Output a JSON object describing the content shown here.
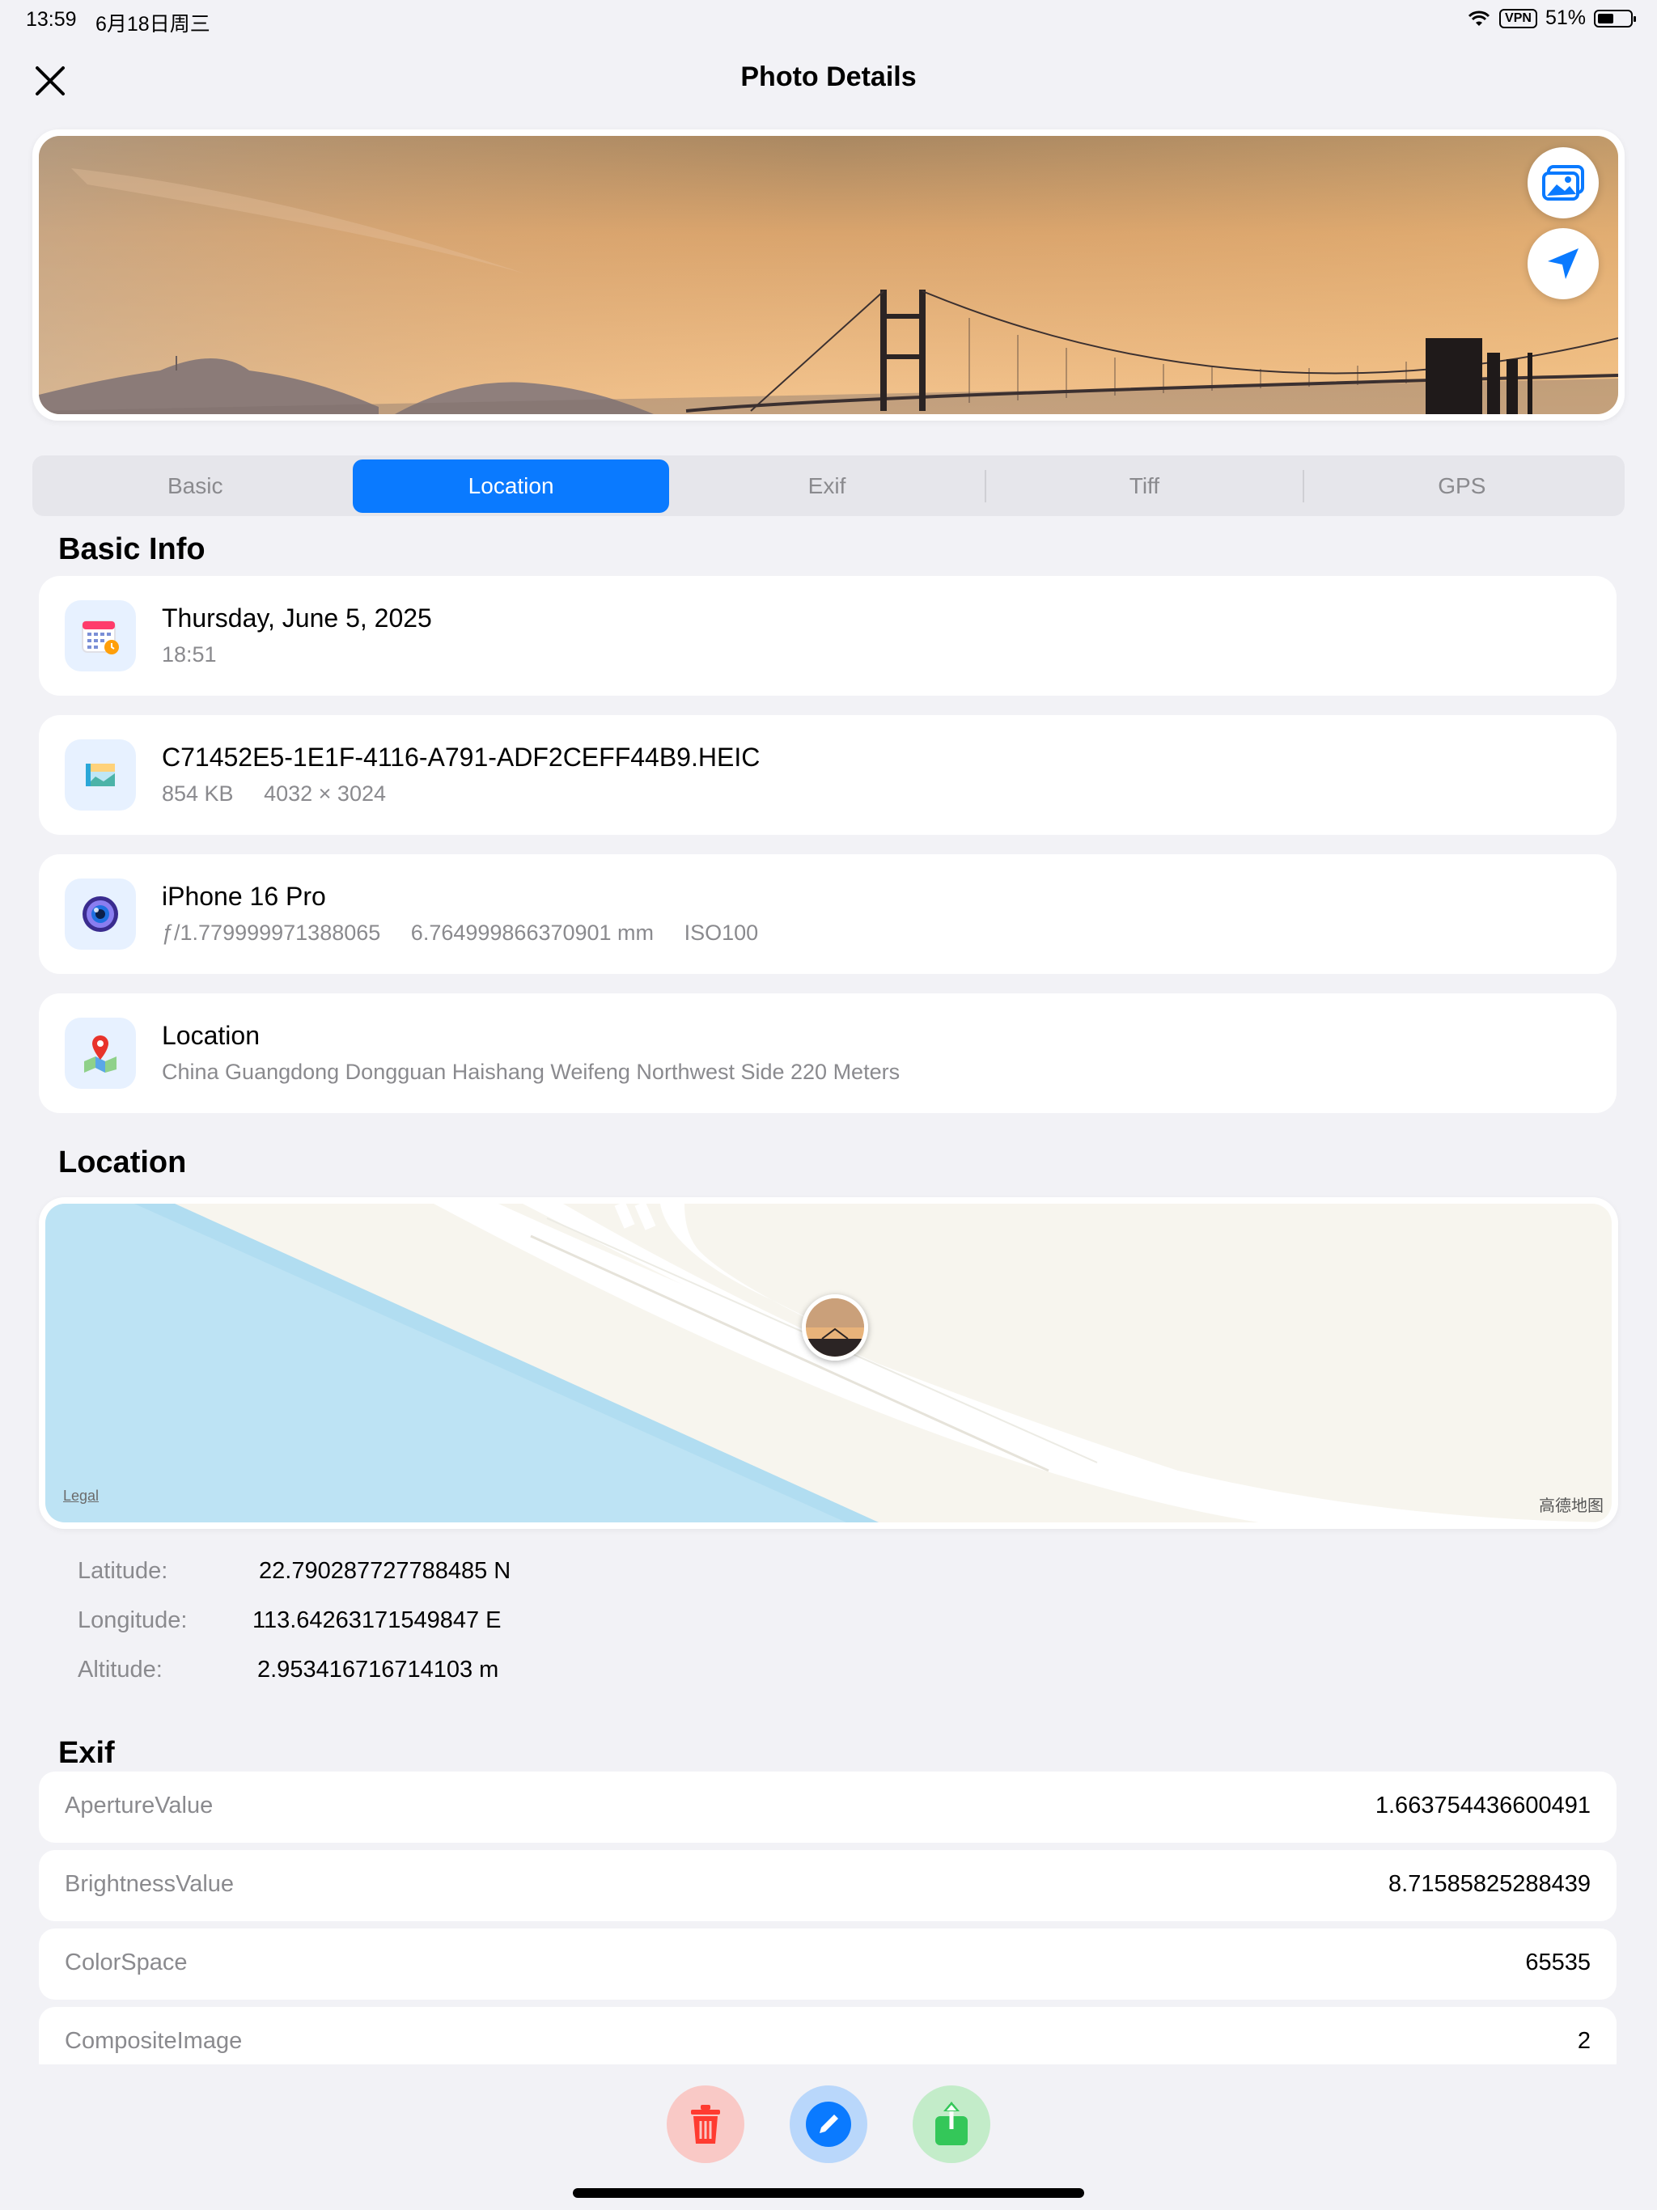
{
  "status_bar": {
    "time": "13:59",
    "date": "6月18日周三",
    "vpn": "VPN",
    "battery_pct": "51%",
    "battery_level": 0.51
  },
  "nav": {
    "title": "Photo Details"
  },
  "tabs": [
    {
      "label": "Basic"
    },
    {
      "label": "Location"
    },
    {
      "label": "Exif"
    },
    {
      "label": "Tiff"
    },
    {
      "label": "GPS"
    }
  ],
  "active_tab": "Location",
  "basic_info": {
    "heading": "Basic Info",
    "date": {
      "title": "Thursday, June 5, 2025",
      "time": "18:51"
    },
    "file": {
      "name": "C71452E5-1E1F-4116-A791-ADF2CEFF44B9.HEIC",
      "size": "854 KB",
      "dimensions": "4032 × 3024"
    },
    "camera": {
      "model": "iPhone 16 Pro",
      "aperture": "ƒ/1.779999971388065",
      "focal_length": "6.764999866370901 mm",
      "iso": "ISO100"
    },
    "location": {
      "title": "Location",
      "address": "China Guangdong Dongguan Haishang Weifeng Northwest Side 220 Meters"
    }
  },
  "location": {
    "heading": "Location",
    "legal": "Legal",
    "map_brand": "高德地图",
    "latitude_label": "Latitude:",
    "latitude": "22.790287727788485 N",
    "longitude_label": "Longitude:",
    "longitude": "113.64263171549847 E",
    "altitude_label": "Altitude:",
    "altitude": "2.953416716714103 m"
  },
  "exif": {
    "heading": "Exif",
    "rows": [
      {
        "key": "ApertureValue",
        "value": "1.663754436600491"
      },
      {
        "key": "BrightnessValue",
        "value": "8.71585825288439"
      },
      {
        "key": "ColorSpace",
        "value": "65535"
      },
      {
        "key": "CompositeImage",
        "value": "2"
      }
    ]
  },
  "colors": {
    "accent": "#0a7aff",
    "delete": "#ff3b30",
    "edit": "#0a7aff",
    "share": "#34c759",
    "background": "#f2f2f6"
  }
}
